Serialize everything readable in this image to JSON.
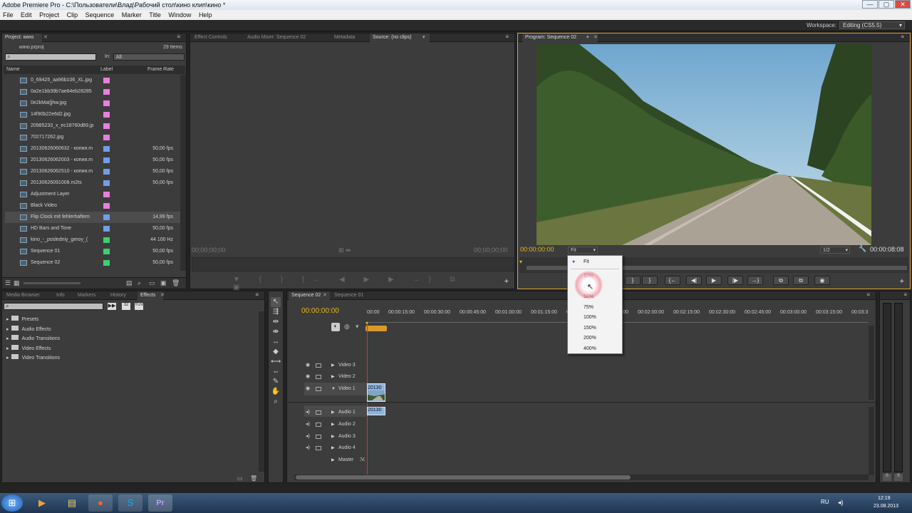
{
  "window": {
    "title": "Adobe Premiere Pro - C:\\Пользователи\\Влад\\Рабочий стол\\кино клип\\кино *",
    "min": "—",
    "max": "▢",
    "close": "✕"
  },
  "menu": [
    "File",
    "Edit",
    "Project",
    "Clip",
    "Sequence",
    "Marker",
    "Title",
    "Window",
    "Help"
  ],
  "workspace": {
    "label": "Workspace:",
    "value": "Editing (CS5.5)"
  },
  "project": {
    "tab": "Project: кино",
    "file": "кино.prproj",
    "count": "29 Items",
    "in_label": "In:",
    "in_value": "All",
    "columns": {
      "name": "Name",
      "label": "Label",
      "rate": "Frame Rate"
    },
    "items": [
      {
        "name": "0_69425_aa96b106_XL.jpg",
        "color": "#e87ee0",
        "rate": ""
      },
      {
        "name": "0a2e1bb39b7ae84eb28285",
        "color": "#e87ee0",
        "rate": ""
      },
      {
        "name": "0e2kMat]jhw.jpg",
        "color": "#e87ee0",
        "rate": ""
      },
      {
        "name": "14f90b22e6d2.jpg",
        "color": "#e87ee0",
        "rate": ""
      },
      {
        "name": "20985233_x_ec18760d89.jp",
        "color": "#e87ee0",
        "rate": ""
      },
      {
        "name": "702717262.jpg",
        "color": "#e87ee0",
        "rate": ""
      },
      {
        "name": "20130626060632 - копия.m",
        "color": "#6f9fe8",
        "rate": "50,00 fps"
      },
      {
        "name": "20130626062003 - копия.m",
        "color": "#6f9fe8",
        "rate": "50,00 fps"
      },
      {
        "name": "20130626062510 - копия.m",
        "color": "#6f9fe8",
        "rate": "50,00 fps"
      },
      {
        "name": "20130626091008.m2ts",
        "color": "#6f9fe8",
        "rate": "50,00 fps"
      },
      {
        "name": "Adjustment Layer",
        "color": "#e87ee0",
        "rate": ""
      },
      {
        "name": "Black Video",
        "color": "#e87ee0",
        "rate": ""
      },
      {
        "name": "Flip Clock mit fehlerhaftem",
        "color": "#6f9fe8",
        "rate": "14,99 fps"
      },
      {
        "name": "HD Bars and Tone",
        "color": "#6f9fe8",
        "rate": "50,00 fps"
      },
      {
        "name": "kino_-_posledniy_geroy_(",
        "color": "#3ccf6e",
        "rate": "44 100 Hz"
      },
      {
        "name": "Sequence 01",
        "color": "#3ccf6e",
        "rate": "50,00 fps"
      },
      {
        "name": "Sequence 02",
        "color": "#3ccf6e",
        "rate": "50,00 fps"
      }
    ]
  },
  "source": {
    "tabs": [
      "Effect Controls",
      "Audio Mixer: Sequence 02",
      "Metadata",
      "Source: (no clips)"
    ],
    "tc_left": "00;00;00;00",
    "tc_right": "00;00;00;00"
  },
  "program": {
    "tab": "Program: Sequence 02",
    "tc_left": "00:00:00:00",
    "fit": "Fit",
    "resolution": "1/2",
    "tc_right": "00:00:08:08",
    "zoom_menu": [
      {
        "label": "Fit",
        "checked": true
      },
      {
        "label": "10%",
        "checked": false
      },
      {
        "label": "25%",
        "checked": false
      },
      {
        "label": "50%",
        "checked": false
      },
      {
        "label": "75%",
        "checked": false
      },
      {
        "label": "100%",
        "checked": false
      },
      {
        "label": "150%",
        "checked": false
      },
      {
        "label": "200%",
        "checked": false
      },
      {
        "label": "400%",
        "checked": false
      }
    ]
  },
  "effects": {
    "tabs": [
      "Media Browser",
      "Info",
      "Markers",
      "History",
      "Effects"
    ],
    "folders": [
      "Presets",
      "Audio Effects",
      "Audio Transitions",
      "Video Effects",
      "Video Transitions"
    ]
  },
  "timeline": {
    "tabs": [
      "Sequence 02",
      "Sequence 01"
    ],
    "tc": "00:00:00:00",
    "ruler": [
      "00:00",
      "00:00:15:00",
      "00:00:30:00",
      "00:00:45:00",
      "00:01:00:00",
      "00:01:15:00",
      "00:01:30:00",
      "00:01:45:00",
      "00:02:00:00",
      "00:02:15:00",
      "00:02:30:00",
      "00:02:45:00",
      "00:03:00:00",
      "00:03:15:00",
      "00:03:3"
    ],
    "tracks": [
      "Video 3",
      "Video 2",
      "Video 1",
      "Audio 1",
      "Audio 2",
      "Audio 3",
      "Audio 4",
      "Master"
    ],
    "clip_label": "20130",
    "audio_clip_label": "20130"
  },
  "taskbar": {
    "lang": "RU",
    "time": "12:19",
    "date": "23.08.2013"
  },
  "colors": {
    "accent": "#e2a32a",
    "panel": "#3c3c3c",
    "timecode": "#e8b51c"
  }
}
